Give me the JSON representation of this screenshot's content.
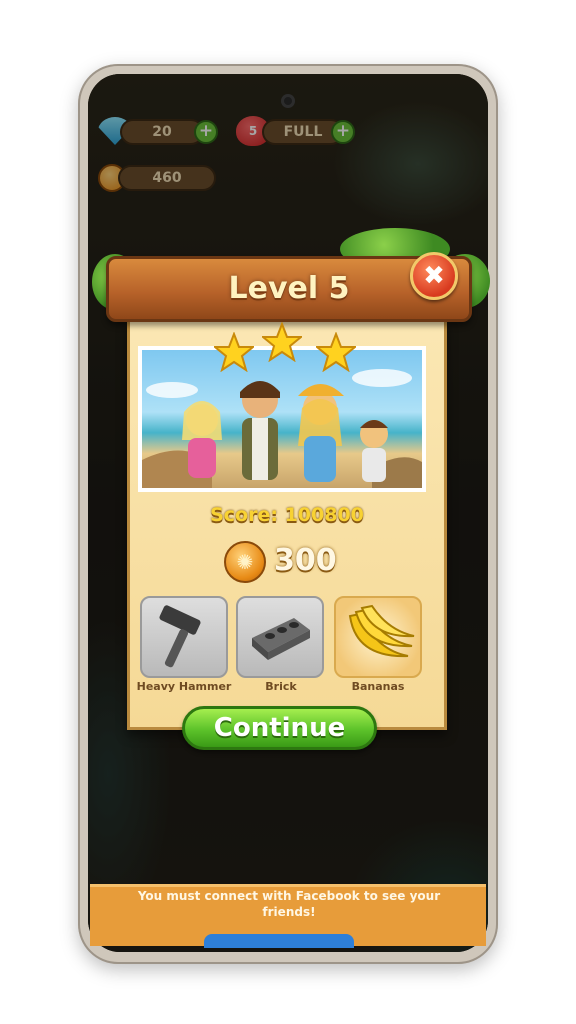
{
  "hud": {
    "gems_value": "20",
    "lives_count": "5",
    "lives_status": "FULL",
    "coins_value": "460",
    "plus_symbol": "+"
  },
  "dialog": {
    "title": "Level 5",
    "close_symbol": "✖",
    "stars_earned": 3,
    "score_text": "Score: 100800",
    "coin_reward": "300",
    "rewards": [
      {
        "label": "Heavy Hammer",
        "icon": "hammer-icon"
      },
      {
        "label": "Brick",
        "icon": "brick-icon"
      },
      {
        "label": "Bananas",
        "icon": "bananas-icon"
      }
    ],
    "continue_label": "Continue"
  },
  "facebook": {
    "message": "You must connect with Facebook to see your friends!"
  },
  "colors": {
    "title_text": "#fff3c0",
    "score_text": "#f8d233",
    "continue_button": "#5cc22a",
    "close_button": "#d83a1f",
    "banner": "#e79c3a"
  }
}
